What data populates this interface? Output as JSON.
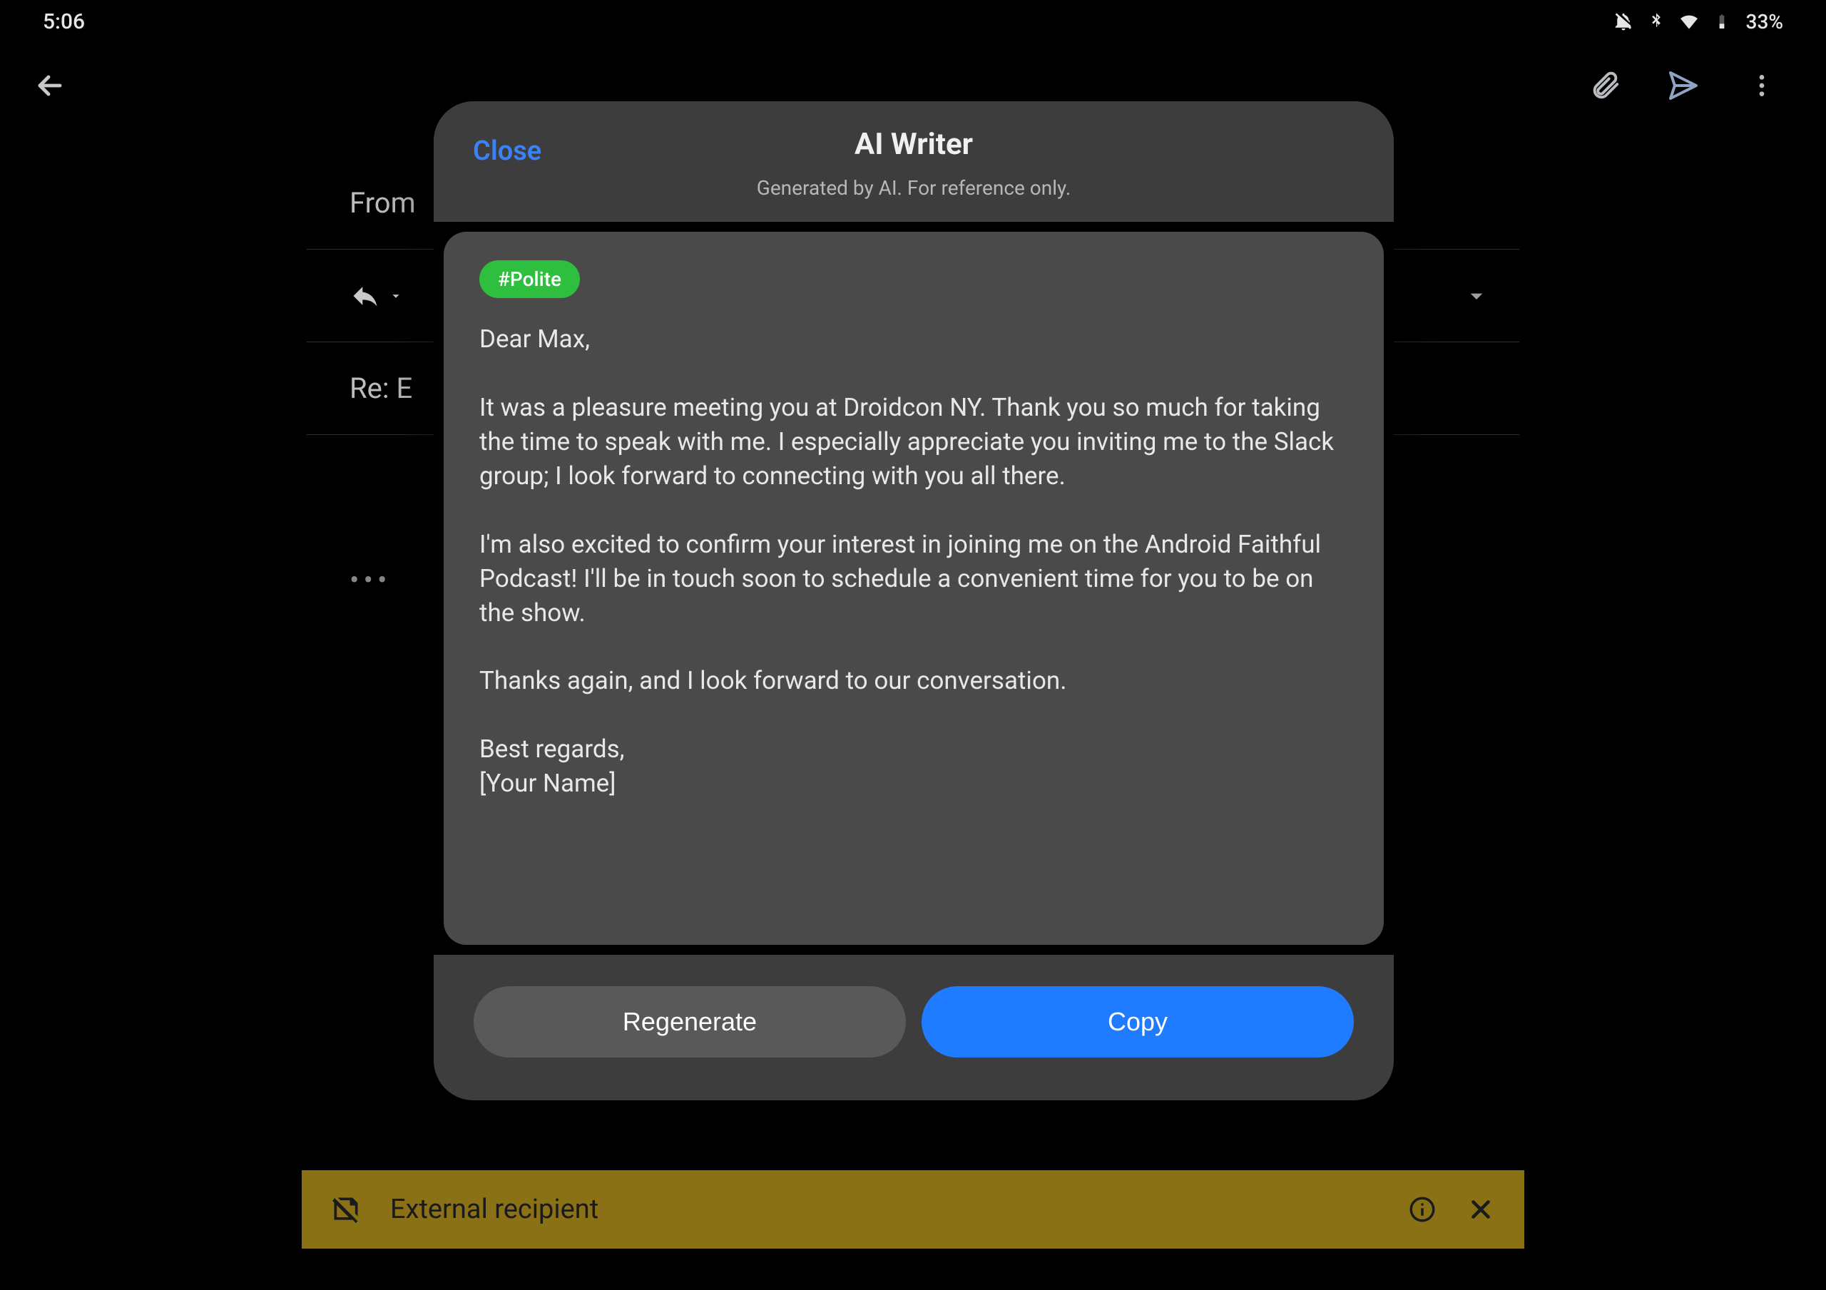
{
  "status": {
    "time": "5:06",
    "battery_percent": "33%"
  },
  "icons": {
    "back": "back-arrow-icon",
    "attach": "paperclip-icon",
    "send": "send-icon",
    "more": "more-vert-icon",
    "reply": "reply-icon",
    "chevron_down": "chevron-down-icon",
    "dots": "more-horiz-icon",
    "bell_off": "notifications-off-icon",
    "bluetooth": "bluetooth-icon",
    "wifi": "wifi-icon",
    "battery": "battery-icon",
    "domain_disabled": "domain-disabled-icon",
    "info": "info-icon",
    "close_x": "close-icon"
  },
  "compose": {
    "from_label": "From",
    "subject": "Re: E",
    "expand_label": "expand"
  },
  "banner": {
    "text": "External recipient"
  },
  "modal": {
    "close_label": "Close",
    "title": "AI Writer",
    "subtitle": "Generated by AI. For reference only.",
    "tone_tag": "#Polite",
    "body": "Dear Max,\n\nIt was a pleasure meeting you at Droidcon NY. Thank you so much for taking the time to speak with me. I especially appreciate you inviting me to the Slack group; I look forward to connecting with you all there.\n\nI'm also excited to confirm your interest in joining me on the Android Faithful Podcast! I'll be in touch soon to schedule a convenient time for you to be on the show.\n\nThanks again, and I look forward to our conversation.\n\nBest regards,\n[Your Name]",
    "regenerate_label": "Regenerate",
    "copy_label": "Copy"
  }
}
